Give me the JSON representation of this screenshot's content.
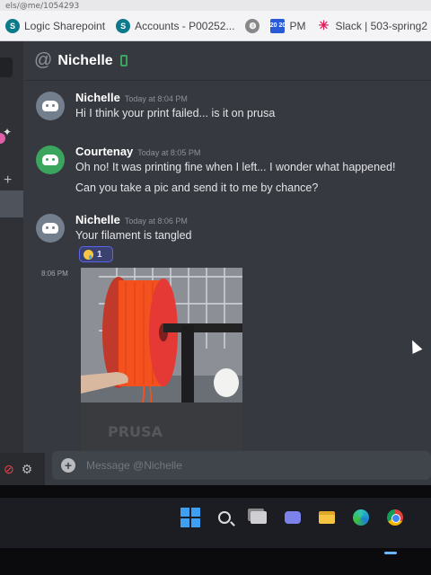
{
  "browser": {
    "url_fragment": "els/@me/1054293",
    "bookmarks": [
      {
        "icon": "sharepoint-icon",
        "label": "Logic Sharepoint"
      },
      {
        "icon": "sharepoint-icon",
        "label": "Accounts - P00252..."
      },
      {
        "icon": "globe-icon",
        "label": ""
      },
      {
        "icon": "calendar-icon",
        "label": "PM",
        "icon_text": "20 20"
      },
      {
        "icon": "slack-icon",
        "label": "Slack | 503-spring2"
      }
    ]
  },
  "header": {
    "title": "Nichelle"
  },
  "messages": [
    {
      "user": "Nichelle",
      "time": "Today at 8:04 PM",
      "lines": [
        "Hi I think your print failed... is it on prusa"
      ]
    },
    {
      "user": "Courtenay",
      "time": "Today at 8:05 PM",
      "lines": [
        "Oh no! It was printing fine when  I left... I wonder what happened!",
        "Can you take a pic and send it to me by chance?"
      ]
    },
    {
      "user": "Nichelle",
      "time": "Today at 8:06 PM",
      "lines": [
        "Your filament is tangled"
      ]
    }
  ],
  "reaction": {
    "emoji": "crying-face",
    "count": "1"
  },
  "attachment": {
    "time": "8:06 PM",
    "printer_label": "PRUSA"
  },
  "composer": {
    "placeholder": "Message @Nichelle"
  },
  "colors": {
    "accent": "#5865f2",
    "online": "#3ba55d",
    "background": "#36393f",
    "filament": "#f4511e"
  }
}
